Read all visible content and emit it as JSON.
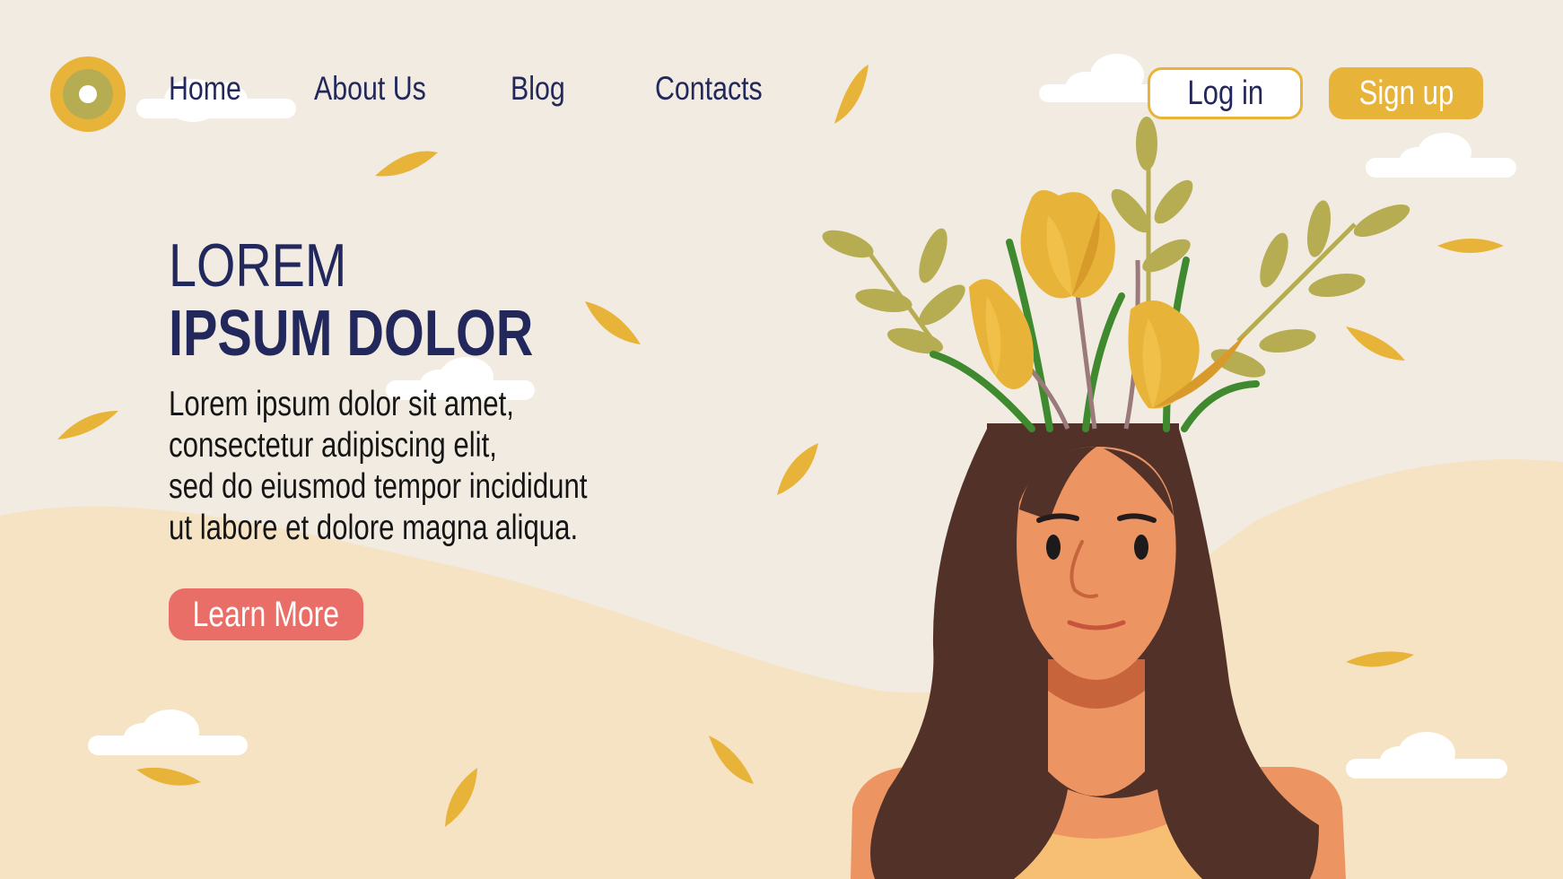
{
  "nav": {
    "items": [
      {
        "label": "Home"
      },
      {
        "label": "About Us"
      },
      {
        "label": "Blog"
      },
      {
        "label": "Contacts"
      }
    ]
  },
  "auth": {
    "login_label": "Log in",
    "signup_label": "Sign up"
  },
  "hero": {
    "title_line1": "LOREM",
    "title_line2": "IPSUM DOLOR",
    "body_lines": [
      "Lorem ipsum dolor sit amet,",
      "consectetur adipiscing elit,",
      "sed do eiusmod tempor incididunt",
      "ut labore et dolore magna aliqua."
    ],
    "cta_label": "Learn More"
  },
  "colors": {
    "background": "#f2ebe1",
    "hill": "#f6e3c3",
    "navy": "#23285c",
    "accent_yellow": "#e8b339",
    "cta_coral": "#ea6e68",
    "hair": "#523228",
    "skin": "#ec9462"
  },
  "icons": {
    "logo": "circle-logo-icon"
  }
}
